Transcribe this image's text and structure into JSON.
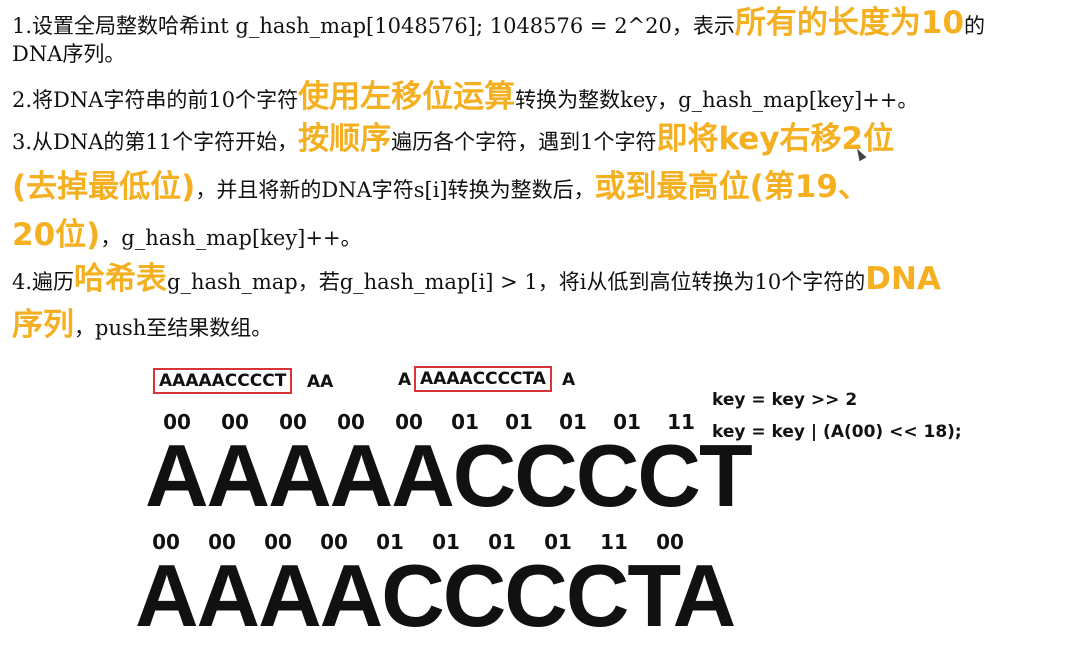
{
  "steps": [
    {
      "line1_pre": "1.设置全局整数哈希int g_hash_map[1048576]; 1048576 = 2^20，表示",
      "line1_hl": "所有的长度为10",
      "line1_post": "的",
      "line2": "DNA序列。"
    },
    {
      "pre": "2.将DNA字符串的前10个字符",
      "hl": "使用左移位运算",
      "post": "转换为整数key，g_hash_map[key]++。"
    },
    {
      "line1_pre": "3.从DNA的第11个字符开始，",
      "line1_hl1": "按顺序",
      "line1_mid": "遍历各个字符，遇到1个字符",
      "line1_hl2": "即将key右移2位",
      "line2_hl1": "(去掉最低位)",
      "line2_mid": "，并且将新的DNA字符s[i]转换为整数后，",
      "line2_hl2": "或到最高位(第19、",
      "line3_hl": "20位)",
      "line3_post": "，g_hash_map[key]++。"
    },
    {
      "line1_pre": "4.遍历",
      "line1_hl1": "哈希表",
      "line1_mid": "g_hash_map，若g_hash_map[i] > 1，将i从低到高位转换为10个字符的",
      "line1_hl2": "DNA",
      "line2_hl": "序列",
      "line2_post": "，push至结果数组。"
    }
  ],
  "diagram": {
    "window1": {
      "boxed": "AAAAACCCCT",
      "after": "AA"
    },
    "window2": {
      "before": "A",
      "boxed": "AAAACCCCTA",
      "after": "A"
    },
    "code_lines": [
      "key = key >> 2",
      "key = key | (A(00) << 18);"
    ],
    "row1": {
      "bits": [
        "00",
        "00",
        "00",
        "00",
        "00",
        "01",
        "01",
        "01",
        "01",
        "11"
      ],
      "letters": "AAAAACCCCT"
    },
    "row2": {
      "bits": [
        "00",
        "00",
        "00",
        "00",
        "01",
        "01",
        "01",
        "01",
        "11",
        "00"
      ],
      "letters": "AAAACCCCTA"
    },
    "colors": {
      "highlight": "#f5b021",
      "box_border": "#d9343a"
    }
  }
}
